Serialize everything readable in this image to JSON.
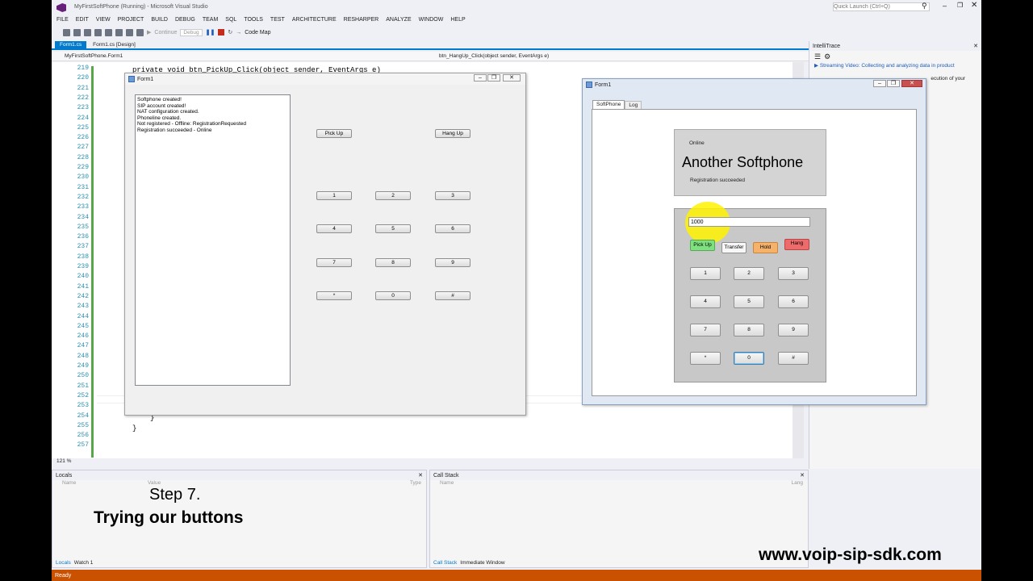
{
  "vs": {
    "window_title": "MyFirstSoftPhone (Running) - Microsoft Visual Studio",
    "quick_launch_placeholder": "Quick Launch (Ctrl+Q)",
    "menu": [
      "FILE",
      "EDIT",
      "VIEW",
      "PROJECT",
      "BUILD",
      "DEBUG",
      "TEAM",
      "SQL",
      "TOOLS",
      "TEST",
      "ARCHITECTURE",
      "RESHARPER",
      "ANALYZE",
      "WINDOW",
      "HELP"
    ],
    "toolbar": {
      "continue_label": "Continue",
      "config": "Debug",
      "codemap_label": "Code Map"
    },
    "doc_tabs": [
      "Form1.cs",
      "Form1.cs [Design]"
    ],
    "nav_left": "MyFirstSoftPhone.Form1",
    "nav_right": "btn_HangUp_Click(object sender, EventArgs e)",
    "line_numbers": [
      "219",
      "220",
      "221",
      "222",
      "223",
      "224",
      "225",
      "226",
      "227",
      "228",
      "229",
      "230",
      "231",
      "232",
      "233",
      "234",
      "235",
      "236",
      "237",
      "238",
      "239",
      "240",
      "241",
      "242",
      "243",
      "244",
      "245",
      "246",
      "247",
      "248",
      "249",
      "250",
      "251",
      "252",
      "253",
      "254",
      "255",
      "256",
      "257"
    ],
    "code_line_top": "private void btn_PickUp_Click(object sender, EventArgs e)",
    "code_brace1": "}",
    "code_brace2": "}",
    "zoom": "121 %",
    "intellitrace": {
      "title": "IntelliTrace",
      "link": "Streaming Video: Collecting and analyzing data in product",
      "text": "ecution of your"
    },
    "locals": {
      "title": "Locals",
      "cols": [
        "Name",
        "Value",
        "Type"
      ],
      "tabs": [
        "Locals",
        "Watch 1"
      ]
    },
    "callstack": {
      "title": "Call Stack",
      "cols": [
        "Name",
        "Lang"
      ],
      "tabs": [
        "Call Stack",
        "Immediate Window"
      ]
    },
    "status": "Ready"
  },
  "form_a": {
    "title": "Form1",
    "log": [
      "Softphone created!",
      "SIP account created!",
      "NAT configuration created.",
      "Phoneline created.",
      "Not registered - Offline: RegistrationRequested",
      "Registration succeeded - Online"
    ],
    "pickup": "Pick Up",
    "hangup": "Hang Up",
    "keys": [
      "1",
      "2",
      "3",
      "4",
      "5",
      "6",
      "7",
      "8",
      "9",
      "*",
      "0",
      "#"
    ]
  },
  "form_b": {
    "title": "Form1",
    "tabs": [
      "SoftPhone",
      "Log"
    ],
    "status": "Online",
    "heading": "Another Softphone",
    "reg": "Registration succeeded",
    "number_value": "1000",
    "pickup": "Pick Up",
    "transfer": "Transfer",
    "hold": "Hold",
    "hang": "Hang",
    "keys": [
      "1",
      "2",
      "3",
      "4",
      "5",
      "6",
      "7",
      "8",
      "9",
      "*",
      "0",
      "#"
    ]
  },
  "overlay": {
    "step": "Step 7.",
    "caption": "Trying our buttons",
    "url": "www.voip-sip-sdk.com"
  },
  "colors": {
    "accent": "#007acc",
    "status_bar": "#ca5100",
    "pickup_green": "#7ee07e",
    "hold_orange": "#f6b26b",
    "hang_red": "#ee6b6b",
    "highlight": "#fff200"
  }
}
